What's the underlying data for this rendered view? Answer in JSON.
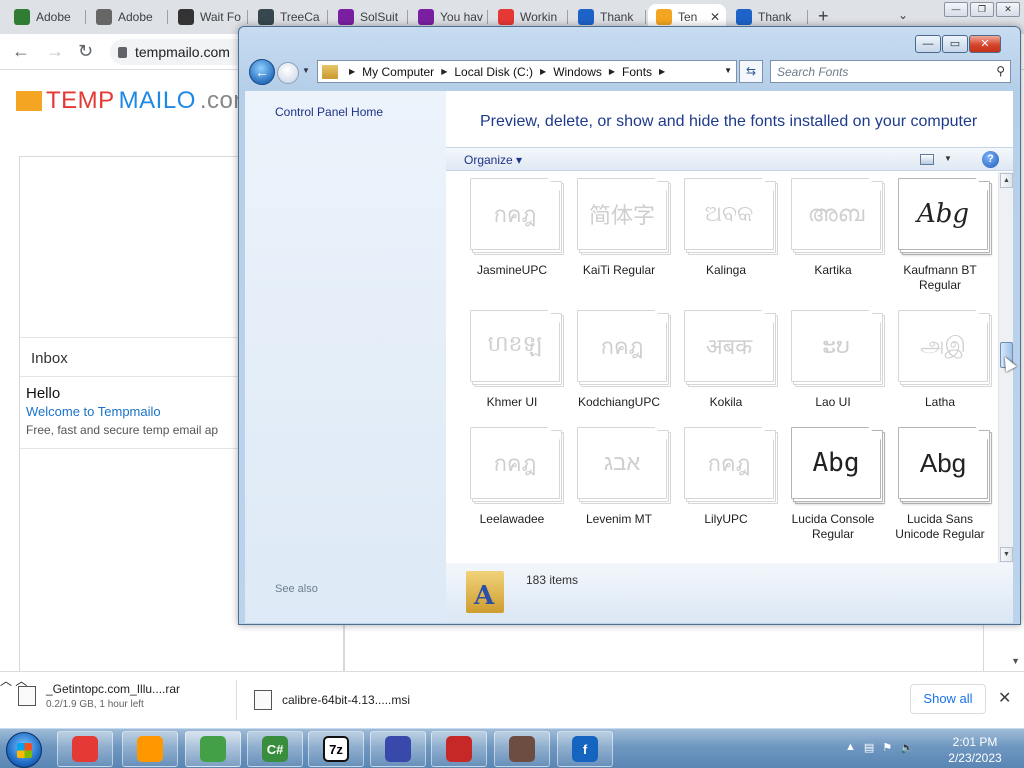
{
  "browser": {
    "tabs": [
      {
        "label": "Adobe",
        "icon": "adobe-green-icon",
        "color": "#2e7d32"
      },
      {
        "label": "Adobe",
        "icon": "solsuite-icon",
        "color": "#666666"
      },
      {
        "label": "Wait Fo",
        "icon": "grammarly-icon",
        "color": "#333333"
      },
      {
        "label": "TreeCa",
        "icon": "treecam-icon",
        "color": "#37474f"
      },
      {
        "label": "SolSuit",
        "icon": "solsuite-icon",
        "color": "#7b1fa2"
      },
      {
        "label": "You hav",
        "icon": "solsuite-icon",
        "color": "#7b1fa2"
      },
      {
        "label": "Workin",
        "icon": "youtube-icon",
        "color": "#e53935"
      },
      {
        "label": "Thank",
        "icon": "globe-icon",
        "color": "#1e63c8"
      },
      {
        "label": "Ten",
        "icon": "tempmailo-icon",
        "color": "#f4a522"
      },
      {
        "label": "Thank",
        "icon": "globe-icon",
        "color": "#1e63c8"
      }
    ],
    "url": "tempmailo.com"
  },
  "page": {
    "logo": {
      "part1": "TEMP",
      "part2": "MAILO",
      "part3": ".com"
    },
    "inbox_label": "Inbox",
    "mail": {
      "from": "Hello",
      "subject": "Welcome to Tempmailo",
      "preview": "Free, fast and secure temp email ap"
    }
  },
  "downloads": {
    "items": [
      {
        "name": "_Getintopc.com_Illu....rar",
        "status": "0.2/1.9 GB, 1 hour left"
      },
      {
        "name": "calibre-64bit-4.13.....msi",
        "status": ""
      }
    ],
    "show_all": "Show all"
  },
  "explorer": {
    "breadcrumb": [
      "My Computer",
      "Local Disk (C:)",
      "Windows",
      "Fonts"
    ],
    "search_placeholder": "Search Fonts",
    "nav": {
      "control_panel_home": "Control Panel Home",
      "see_also": "See also"
    },
    "heading": "Preview, delete, or show and hide the fonts installed on your computer",
    "organize": "Organize",
    "fonts": [
      {
        "name": "JasmineUPC",
        "sample": "กคฎ",
        "style": "faded"
      },
      {
        "name": "KaiTi Regular",
        "sample": "简体字",
        "style": "faded"
      },
      {
        "name": "Kalinga",
        "sample": "ଅବକ",
        "style": "faded"
      },
      {
        "name": "Kartika",
        "sample": "അബ",
        "style": "faded"
      },
      {
        "name": "Kaufmann BT Regular",
        "sample": "Abg",
        "style": "dark-script"
      },
      {
        "name": "Khmer UI",
        "sample": "ហខឡ",
        "style": "faded"
      },
      {
        "name": "KodchiangUPC",
        "sample": "กคฎ",
        "style": "faded"
      },
      {
        "name": "Kokila",
        "sample": "अबक",
        "style": "faded"
      },
      {
        "name": "Lao UI",
        "sample": "ະບ",
        "style": "faded"
      },
      {
        "name": "Latha",
        "sample": "அஇ",
        "style": "faded"
      },
      {
        "name": "Leelawadee",
        "sample": "กคฎ",
        "style": "faded"
      },
      {
        "name": "Levenim MT",
        "sample": "אבג",
        "style": "faded"
      },
      {
        "name": "LilyUPC",
        "sample": "กคฎ",
        "style": "faded"
      },
      {
        "name": "Lucida Console Regular",
        "sample": "Abg",
        "style": "dark-mono"
      },
      {
        "name": "Lucida Sans Unicode Regular",
        "sample": "Abg",
        "style": "dark"
      }
    ],
    "item_count": "183 items"
  },
  "taskbar": {
    "apps": [
      {
        "name": "chrome-old-icon",
        "label": "",
        "color": "#e53935"
      },
      {
        "name": "media-player-icon",
        "label": "",
        "color": "#ff9800"
      },
      {
        "name": "chrome-icon",
        "label": "",
        "color": "#43a047"
      },
      {
        "name": "csharp-icon",
        "label": "C#",
        "color": "#388e3c"
      },
      {
        "name": "7zip-icon",
        "label": "7z",
        "color": "#111111"
      },
      {
        "name": "installer-icon",
        "label": "",
        "color": "#3949ab"
      },
      {
        "name": "solitaire-icon",
        "label": "",
        "color": "#c62828"
      },
      {
        "name": "books-icon",
        "label": "",
        "color": "#6d4c41"
      },
      {
        "name": "fontforge-icon",
        "label": "f",
        "color": "#1565c0"
      }
    ],
    "time": "2:01 PM",
    "date": "2/23/2023"
  }
}
